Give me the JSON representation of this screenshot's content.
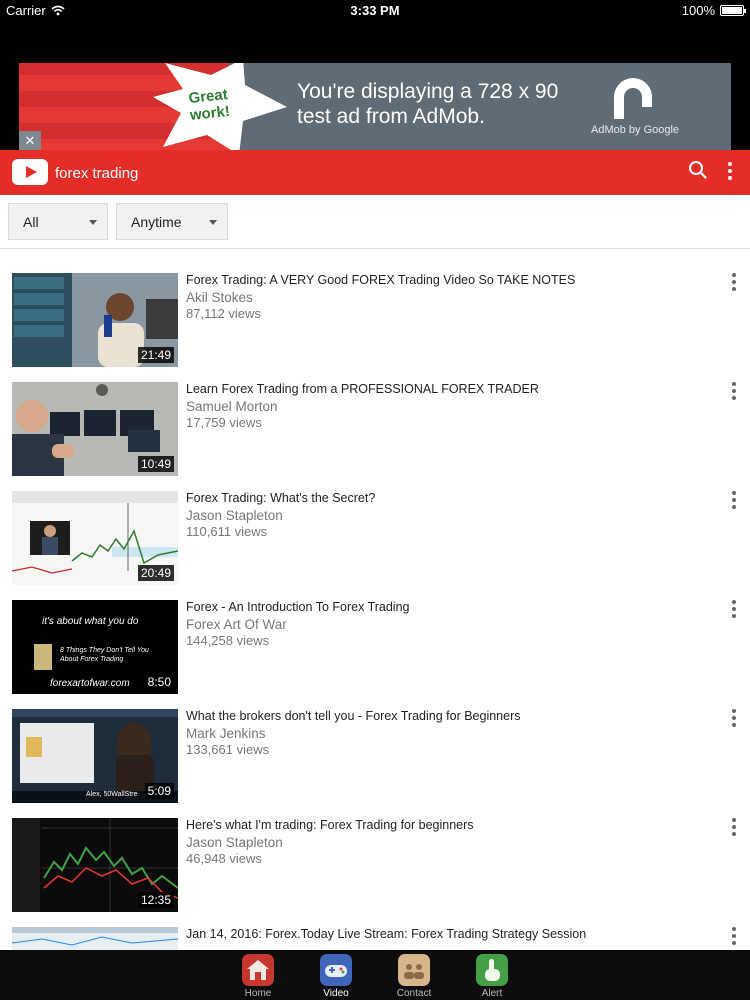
{
  "status_bar": {
    "carrier": "Carrier",
    "time": "3:33 PM",
    "battery": "100%"
  },
  "ad": {
    "badge_line1": "Great",
    "badge_line2": "work!",
    "text_line1": "You're displaying a 728 x 90",
    "text_line2": "test ad from AdMob.",
    "logo_label": "AdMob by Google",
    "close_label": "✕"
  },
  "header": {
    "query": "forex trading",
    "search_icon": "search-icon",
    "more_icon": "more-vertical-icon"
  },
  "filters": [
    {
      "label": "All"
    },
    {
      "label": "Anytime"
    }
  ],
  "videos": [
    {
      "title": "Forex Trading: A VERY Good FOREX Trading Video So TAKE NOTES",
      "channel": "Akil Stokes",
      "views": "87,112 views",
      "duration": "21:49"
    },
    {
      "title": "Learn Forex Trading from a PROFESSIONAL FOREX TRADER",
      "channel": "Samuel Morton",
      "views": "17,759 views",
      "duration": "10:49"
    },
    {
      "title": "Forex Trading: What's the Secret?",
      "channel": "Jason Stapleton",
      "views": "110,611 views",
      "duration": "20:49"
    },
    {
      "title": "Forex - An Introduction To Forex Trading",
      "channel": "Forex Art Of War",
      "views": "144,258 views",
      "duration": "8:50",
      "thumb_line1": "it's about what you do",
      "thumb_line2": "8 Things They Don't Tell You About Forex Trading",
      "thumb_line3": "forexartofwar.com"
    },
    {
      "title": "What the brokers don't tell you - Forex Trading for Beginners",
      "channel": "Mark Jenkins",
      "views": "133,661 views",
      "duration": "5:09",
      "thumb_line1": "Alex, 50WallStre"
    },
    {
      "title": "Here's what I'm trading: Forex Trading for beginners",
      "channel": "Jason Stapleton",
      "views": "46,948 views",
      "duration": "12:35"
    },
    {
      "title": "Jan 14, 2016: Forex.Today Live Stream: Forex Trading Strategy Session",
      "channel": "",
      "views": "",
      "duration": ""
    }
  ],
  "tabs": [
    {
      "label": "Home",
      "icon": "home-icon"
    },
    {
      "label": "Video",
      "icon": "gamepad-icon"
    },
    {
      "label": "Contact",
      "icon": "contacts-icon"
    },
    {
      "label": "Alert",
      "icon": "pointer-hand-icon"
    }
  ],
  "colors": {
    "header_red": "#e52d27",
    "ad_gray": "#5f6b75",
    "tab_bar": "#0d0d0d"
  }
}
